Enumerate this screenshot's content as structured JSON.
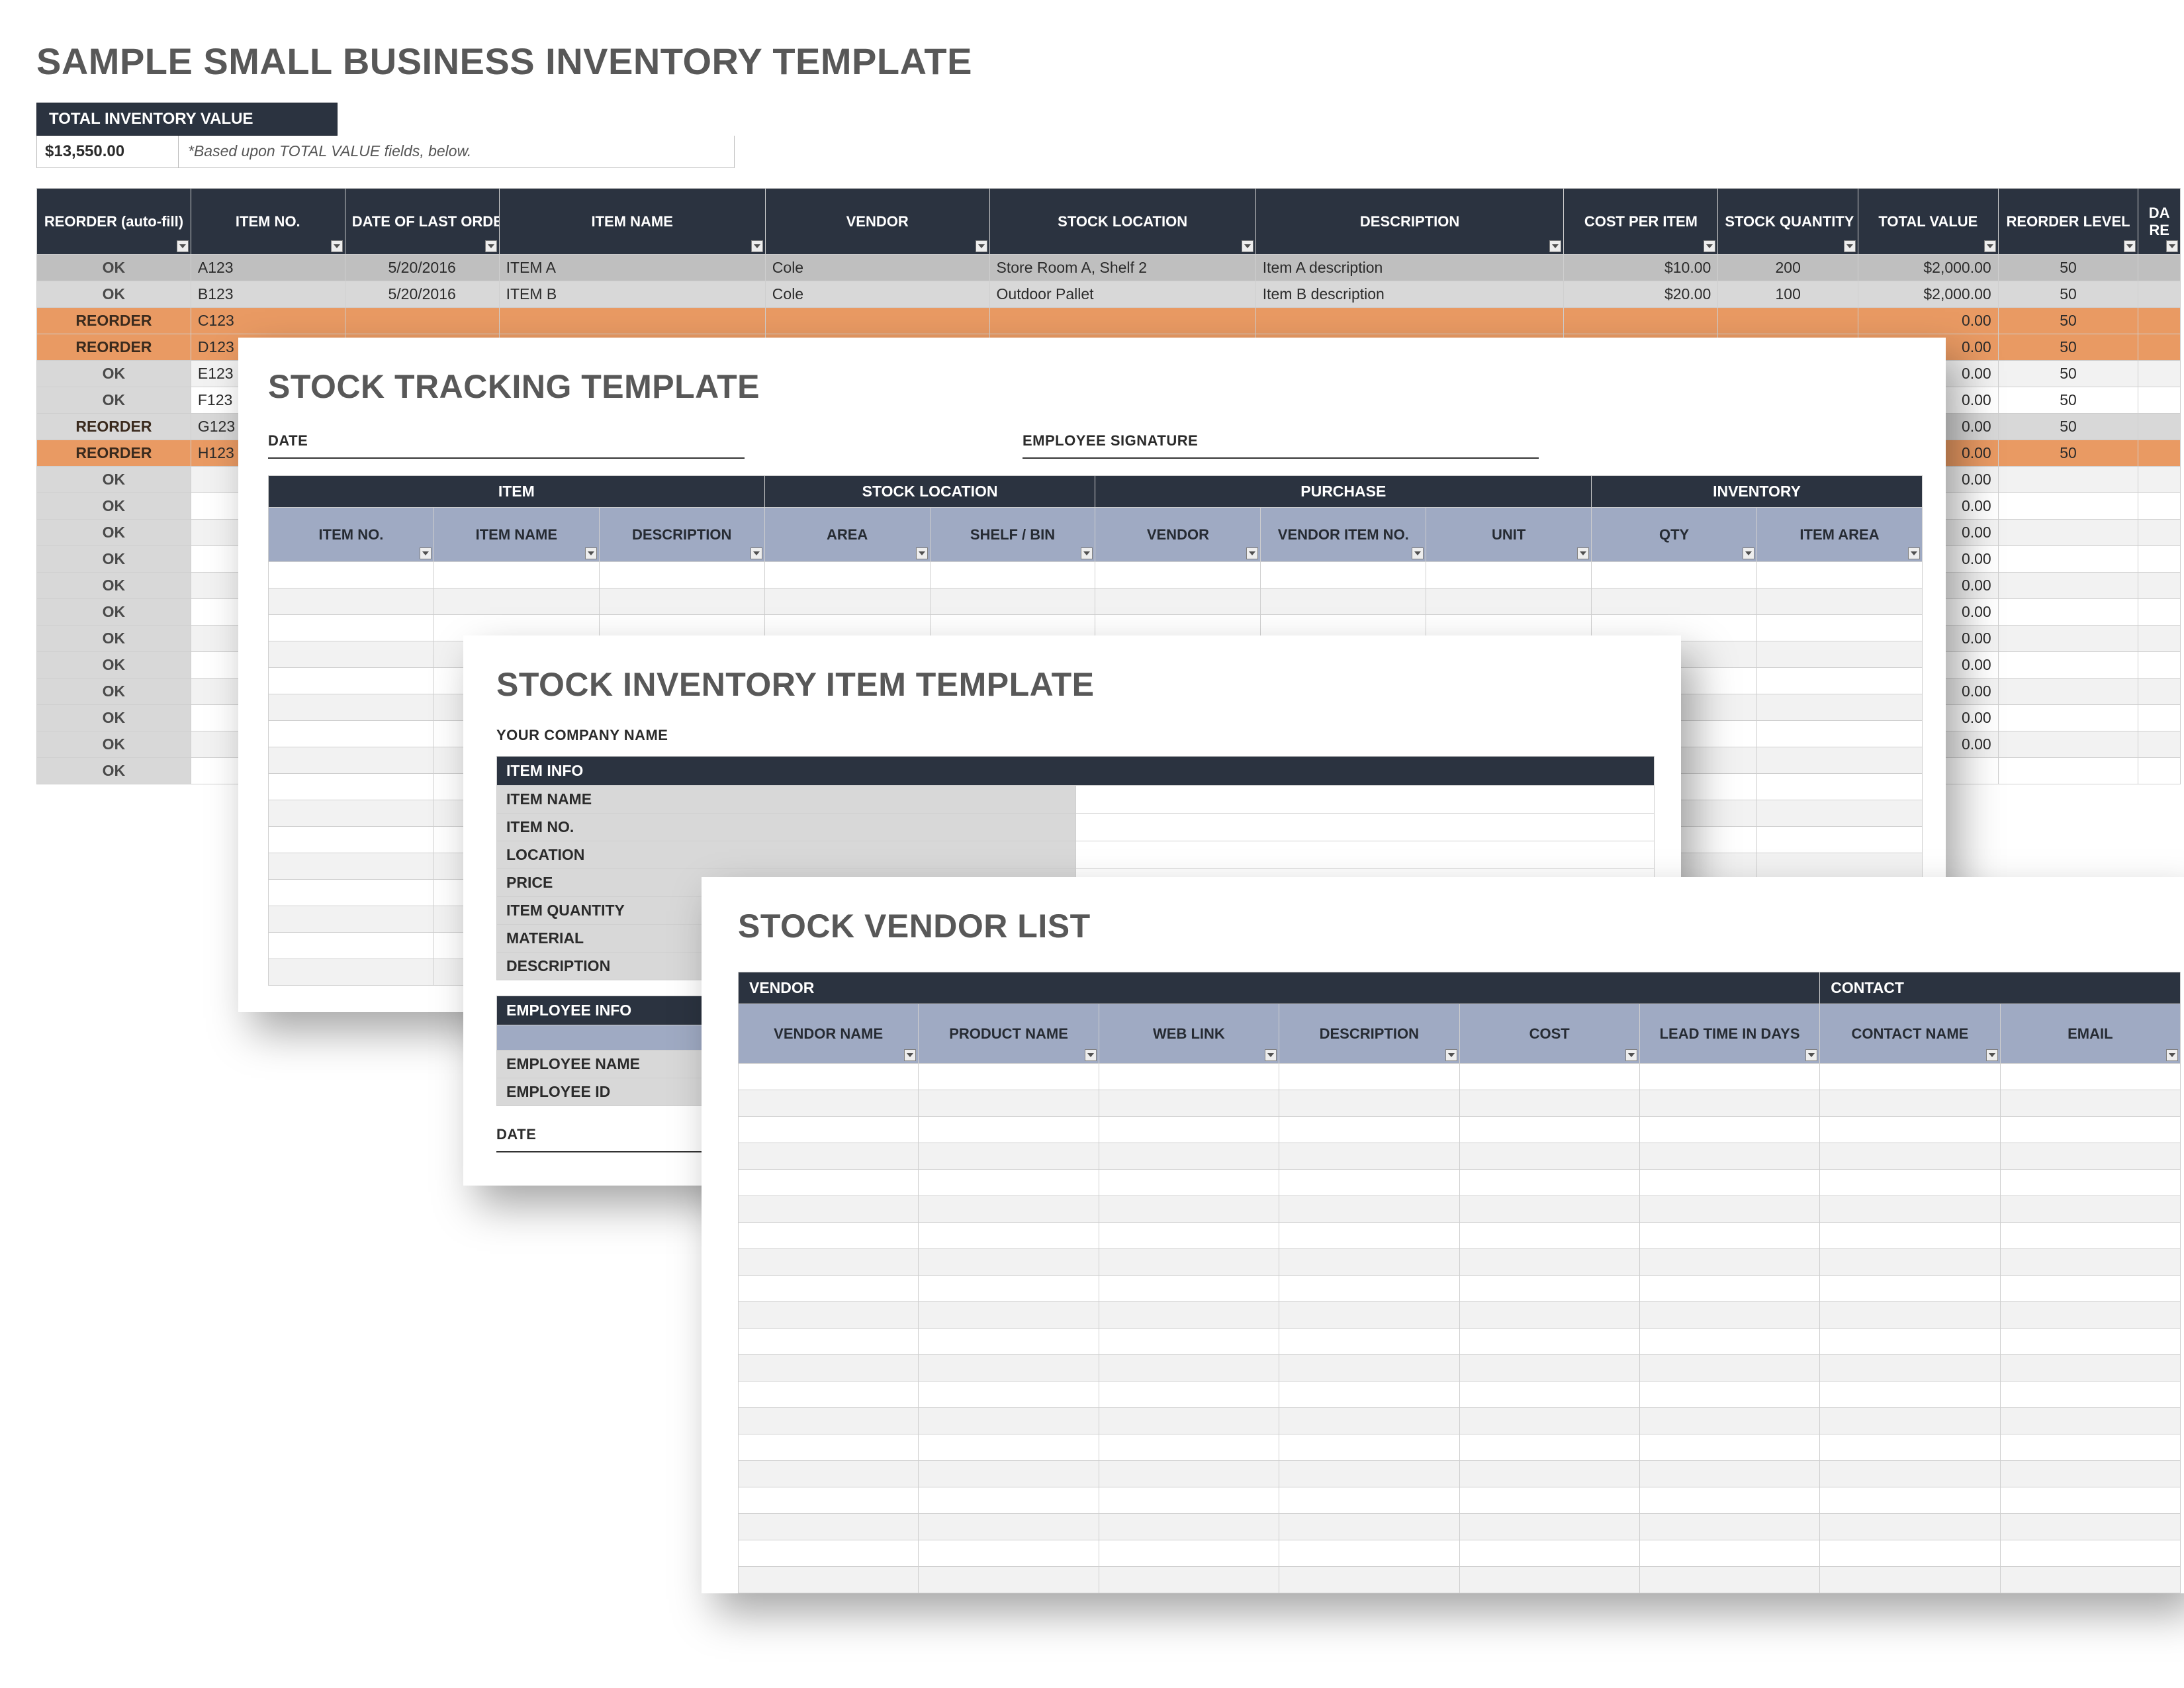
{
  "colors": {
    "dark": "#2b3340",
    "slate": "#9faac3",
    "silver": "#d8d8d8",
    "orange": "#e99a63"
  },
  "main": {
    "title": "SAMPLE SMALL BUSINESS INVENTORY TEMPLATE",
    "total_label": "TOTAL INVENTORY VALUE",
    "total_value": "$13,550.00",
    "total_note": "*Based upon TOTAL VALUE fields, below.",
    "cols": [
      "REORDER (auto-fill)",
      "ITEM NO.",
      "DATE OF LAST ORDER",
      "ITEM NAME",
      "VENDOR",
      "STOCK LOCATION",
      "DESCRIPTION",
      "COST PER ITEM",
      "STOCK QUANTITY",
      "TOTAL VALUE",
      "REORDER LEVEL",
      "DA\nRE"
    ],
    "rows": [
      {
        "cls": "rowA",
        "status": "OK",
        "ino": "A123",
        "date": "5/20/2016",
        "name": "ITEM A",
        "vendor": "Cole",
        "loc": "Store Room A, Shelf 2",
        "desc": "Item A description",
        "cost": "$10.00",
        "qty": "200",
        "total": "$2,000.00",
        "rl": "50"
      },
      {
        "cls": "rowB",
        "status": "OK",
        "ino": "B123",
        "date": "5/20/2016",
        "name": "ITEM B",
        "vendor": "Cole",
        "loc": "Outdoor Pallet",
        "desc": "Item B description",
        "cost": "$20.00",
        "qty": "100",
        "total": "$2,000.00",
        "rl": "50"
      },
      {
        "cls": "rowC",
        "status": "REORDER",
        "ino": "C123",
        "date": "",
        "name": "",
        "vendor": "",
        "loc": "",
        "desc": "",
        "cost": "",
        "qty": "",
        "total": "0.00",
        "rl": "50"
      },
      {
        "cls": "rowD",
        "status": "REORDER",
        "ino": "D123",
        "date": "",
        "name": "",
        "vendor": "",
        "loc": "",
        "desc": "",
        "cost": "",
        "qty": "",
        "total": "0.00",
        "rl": "50"
      },
      {
        "cls": "",
        "status": "OK",
        "ino": "E123",
        "date": "",
        "name": "",
        "vendor": "",
        "loc": "",
        "desc": "",
        "cost": "",
        "qty": "",
        "total": "0.00",
        "rl": "50"
      },
      {
        "cls": "",
        "status": "OK",
        "ino": "F123",
        "date": "",
        "name": "",
        "vendor": "",
        "loc": "",
        "desc": "",
        "cost": "",
        "qty": "",
        "total": "0.00",
        "rl": "50"
      },
      {
        "cls": "rowG",
        "status": "REORDER",
        "ino": "G123",
        "date": "",
        "name": "",
        "vendor": "",
        "loc": "",
        "desc": "",
        "cost": "",
        "qty": "",
        "total": "0.00",
        "rl": "50"
      },
      {
        "cls": "rowH",
        "status": "REORDER",
        "ino": "H123",
        "date": "",
        "name": "",
        "vendor": "",
        "loc": "",
        "desc": "",
        "cost": "",
        "qty": "",
        "total": "0.00",
        "rl": "50"
      },
      {
        "cls": "",
        "status": "OK",
        "ino": "",
        "date": "",
        "name": "",
        "vendor": "",
        "loc": "",
        "desc": "",
        "cost": "",
        "qty": "",
        "total": "0.00",
        "rl": ""
      },
      {
        "cls": "",
        "status": "OK",
        "ino": "",
        "date": "",
        "name": "",
        "vendor": "",
        "loc": "",
        "desc": "",
        "cost": "",
        "qty": "",
        "total": "0.00",
        "rl": ""
      },
      {
        "cls": "",
        "status": "OK",
        "ino": "",
        "date": "",
        "name": "",
        "vendor": "",
        "loc": "",
        "desc": "",
        "cost": "",
        "qty": "",
        "total": "0.00",
        "rl": ""
      },
      {
        "cls": "",
        "status": "OK",
        "ino": "",
        "date": "",
        "name": "",
        "vendor": "",
        "loc": "",
        "desc": "",
        "cost": "",
        "qty": "",
        "total": "0.00",
        "rl": ""
      },
      {
        "cls": "",
        "status": "OK",
        "ino": "",
        "date": "",
        "name": "",
        "vendor": "",
        "loc": "",
        "desc": "",
        "cost": "",
        "qty": "",
        "total": "0.00",
        "rl": ""
      },
      {
        "cls": "",
        "status": "OK",
        "ino": "",
        "date": "",
        "name": "",
        "vendor": "",
        "loc": "",
        "desc": "",
        "cost": "",
        "qty": "",
        "total": "0.00",
        "rl": ""
      },
      {
        "cls": "",
        "status": "OK",
        "ino": "",
        "date": "",
        "name": "",
        "vendor": "",
        "loc": "",
        "desc": "",
        "cost": "",
        "qty": "",
        "total": "0.00",
        "rl": ""
      },
      {
        "cls": "",
        "status": "OK",
        "ino": "",
        "date": "",
        "name": "",
        "vendor": "",
        "loc": "",
        "desc": "",
        "cost": "",
        "qty": "",
        "total": "0.00",
        "rl": ""
      },
      {
        "cls": "",
        "status": "OK",
        "ino": "",
        "date": "",
        "name": "",
        "vendor": "",
        "loc": "",
        "desc": "",
        "cost": "",
        "qty": "",
        "total": "0.00",
        "rl": ""
      },
      {
        "cls": "",
        "status": "OK",
        "ino": "",
        "date": "",
        "name": "",
        "vendor": "",
        "loc": "",
        "desc": "",
        "cost": "",
        "qty": "",
        "total": "0.00",
        "rl": ""
      },
      {
        "cls": "",
        "status": "OK",
        "ino": "",
        "date": "",
        "name": "",
        "vendor": "",
        "loc": "",
        "desc": "",
        "cost": "",
        "qty": "",
        "total": "0.00",
        "rl": ""
      },
      {
        "cls": "",
        "status": "OK",
        "ino": "",
        "date": "",
        "name": "",
        "vendor": "",
        "loc": "",
        "desc": "",
        "cost": "",
        "qty": "",
        "total": "",
        "rl": ""
      }
    ]
  },
  "stocktrack": {
    "title": "STOCK TRACKING TEMPLATE",
    "date_label": "DATE",
    "sig_label": "EMPLOYEE SIGNATURE",
    "groups": [
      "ITEM",
      "STOCK LOCATION",
      "PURCHASE",
      "INVENTORY"
    ],
    "cols": [
      "ITEM NO.",
      "ITEM NAME",
      "DESCRIPTION",
      "AREA",
      "SHELF / BIN",
      "VENDOR",
      "VENDOR ITEM NO.",
      "UNIT",
      "QTY",
      "ITEM AREA"
    ],
    "blank_rows": 16
  },
  "stockitem": {
    "title": "STOCK INVENTORY ITEM TEMPLATE",
    "company_label": "YOUR COMPANY NAME",
    "section1": "ITEM INFO",
    "fields1": [
      "ITEM NAME",
      "ITEM NO.",
      "LOCATION",
      "PRICE",
      "ITEM QUANTITY",
      "MATERIAL",
      "DESCRIPTION"
    ],
    "section2": "EMPLOYEE INFO",
    "fields2": [
      "EMPLOYEE NAME",
      "EMPLOYEE ID"
    ],
    "date_label": "DATE"
  },
  "vendorlist": {
    "title": "STOCK VENDOR LIST",
    "groups": [
      "VENDOR",
      "CONTACT"
    ],
    "cols": [
      "VENDOR NAME",
      "PRODUCT NAME",
      "WEB LINK",
      "DESCRIPTION",
      "COST",
      "LEAD TIME IN DAYS",
      "CONTACT NAME",
      "EMAIL"
    ],
    "blank_rows": 20
  }
}
